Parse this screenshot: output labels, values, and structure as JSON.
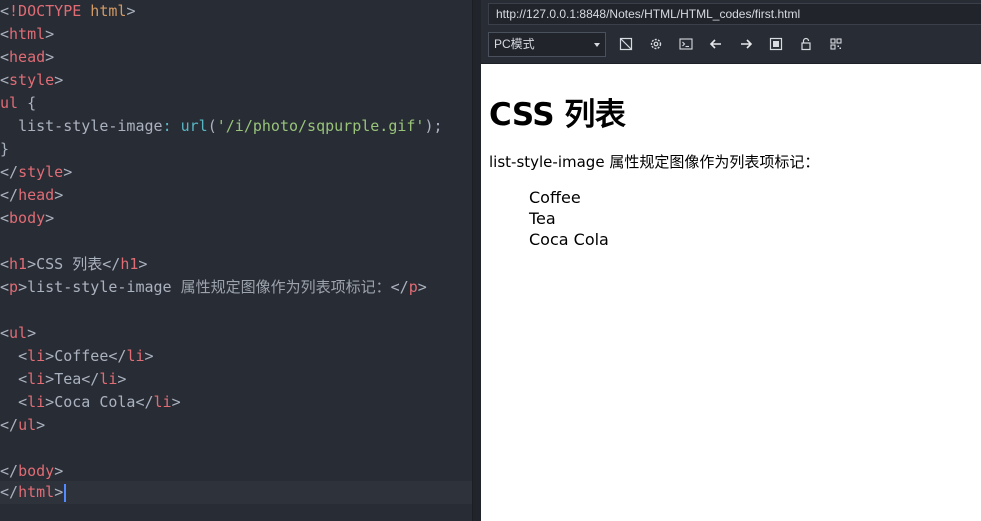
{
  "editor": {
    "lines": {
      "l1": {
        "open": "<",
        "bang": "!DOCTYPE",
        "kw": " html",
        "close": ">"
      },
      "l2": {
        "lt": "<",
        "tag": "html",
        "gt": ">"
      },
      "l3": {
        "lt": "<",
        "tag": "head",
        "gt": ">"
      },
      "l4": {
        "lt": "<",
        "tag": "style",
        "gt": ">"
      },
      "l5": {
        "selector": "ul",
        "brace": " {"
      },
      "l6": {
        "indent": "  ",
        "prop": "list-style-image",
        "colon": ": ",
        "fn": "url",
        "paren_open": "(",
        "str": "'/i/photo/sqpurple.gif'",
        "paren_close": ")",
        "semi": ";"
      },
      "l7": {
        "brace": "}"
      },
      "l8": {
        "lt": "</",
        "tag": "style",
        "gt": ">"
      },
      "l9": {
        "lt": "</",
        "tag": "head",
        "gt": ">"
      },
      "l10": {
        "lt": "<",
        "tag": "body",
        "gt": ">"
      },
      "l12": {
        "lt": "<",
        "tag": "h1",
        "gt": ">",
        "text": "CSS 列表",
        "lt2": "</",
        "tag2": "h1",
        "gt2": ">"
      },
      "l13": {
        "lt": "<",
        "tag": "p",
        "gt": ">",
        "text": "list-style-image ",
        "cjk": "属性规定图像作为列表项标记：",
        "lt2": "</",
        "tag2": "p",
        "gt2": ">"
      },
      "l15": {
        "lt": "<",
        "tag": "ul",
        "gt": ">"
      },
      "l16": {
        "indent": "  ",
        "lt": "<",
        "tag": "li",
        "gt": ">",
        "text": "Coffee",
        "lt2": "</",
        "tag2": "li",
        "gt2": ">"
      },
      "l17": {
        "indent": "  ",
        "lt": "<",
        "tag": "li",
        "gt": ">",
        "text": "Tea",
        "lt2": "</",
        "tag2": "li",
        "gt2": ">"
      },
      "l18": {
        "indent": "  ",
        "lt": "<",
        "tag": "li",
        "gt": ">",
        "text": "Coca Cola",
        "lt2": "</",
        "tag2": "li",
        "gt2": ">"
      },
      "l19": {
        "lt": "</",
        "tag": "ul",
        "gt": ">"
      },
      "l21": {
        "lt": "</",
        "tag": "body",
        "gt": ">"
      },
      "l22": {
        "lt": "</",
        "tag": "html",
        "gt": ">"
      }
    }
  },
  "browser": {
    "url": "http://127.0.0.1:8848/Notes/HTML/HTML_codes/first.html",
    "mode": "PC模式",
    "toolbar_icons": [
      "screenshot-icon",
      "settings-icon",
      "console-icon",
      "back-arrow-icon",
      "forward-arrow-icon",
      "stop-icon",
      "lock-icon",
      "qrcode-icon"
    ]
  },
  "page": {
    "heading": "CSS 列表",
    "paragraph": "list-style-image 属性规定图像作为列表项标记：",
    "items": [
      "Coffee",
      "Tea",
      "Coca Cola"
    ]
  },
  "colors": {
    "editor_bg": "#282c34",
    "tag": "#e06c75",
    "string": "#98c379",
    "function": "#56b6c2",
    "keyword": "#d19a66",
    "cursor": "#528bff"
  }
}
